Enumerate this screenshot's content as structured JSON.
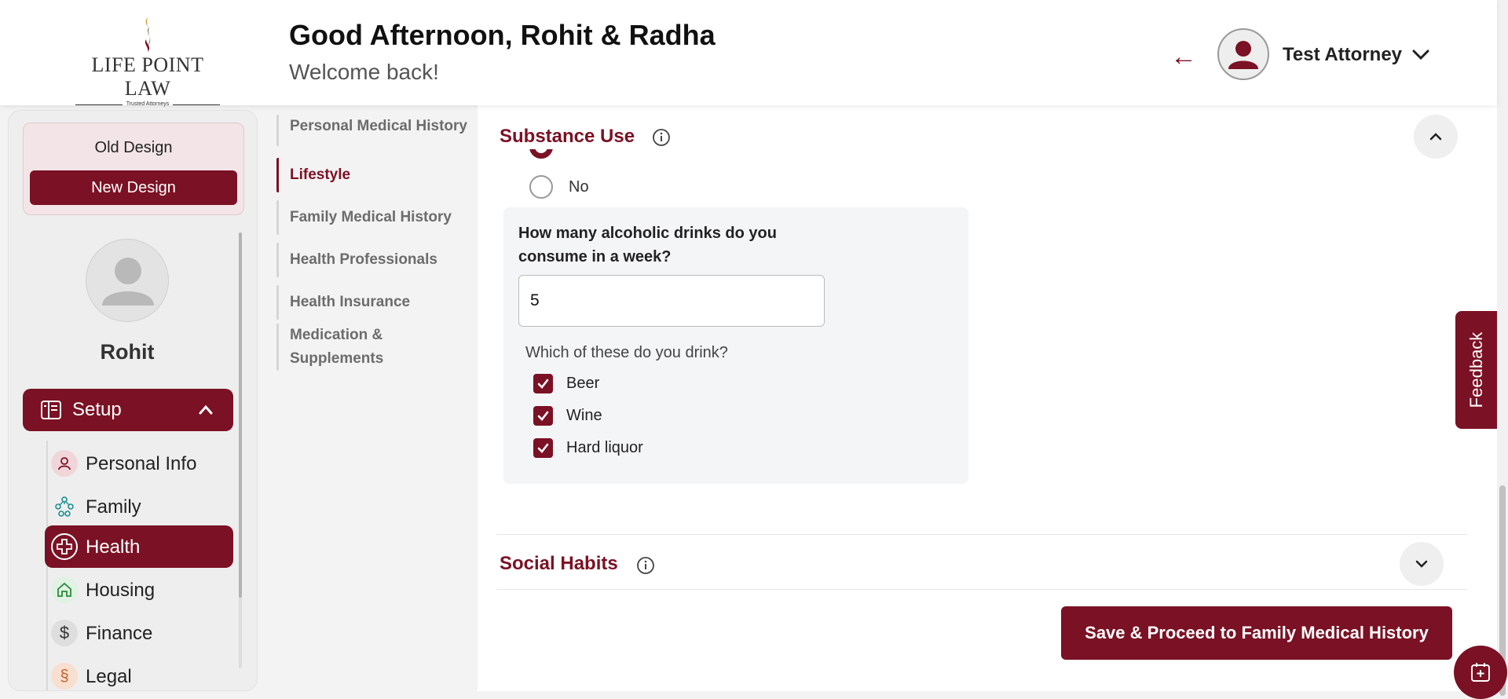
{
  "header": {
    "logo_text": "LIFE POINT LAW",
    "logo_tagline": "Trusted Attorneys",
    "greeting": "Good Afternoon, Rohit & Radha",
    "subtitle": "Welcome back!",
    "user_name": "Test Attorney"
  },
  "sidebar": {
    "old_design": "Old Design",
    "new_design": "New Design",
    "profile_name": "Rohit",
    "setup_label": "Setup",
    "items": [
      {
        "label": "Personal Info",
        "icon": "person-icon"
      },
      {
        "label": "Family",
        "icon": "family-tree-icon"
      },
      {
        "label": "Health",
        "icon": "medical-cross-icon"
      },
      {
        "label": "Housing",
        "icon": "house-icon"
      },
      {
        "label": "Finance",
        "icon": "dollar-icon"
      },
      {
        "label": "Legal",
        "icon": "legal-icon"
      }
    ]
  },
  "subnav": {
    "items": [
      "Personal Medical History",
      "Lifestyle",
      "Family Medical History",
      "Health Professionals",
      "Health Insurance",
      "Medication & Supplements"
    ],
    "active": "Lifestyle"
  },
  "main": {
    "substance_title": "Substance Use",
    "radio_no": "No",
    "question": "How many alcoholic drinks do you consume in a week?",
    "drinks_value": "5",
    "drink_types_label": "Which of these do you drink?",
    "drink_options": [
      {
        "label": "Beer",
        "checked": true
      },
      {
        "label": "Wine",
        "checked": true
      },
      {
        "label": "Hard liquor",
        "checked": true
      }
    ],
    "social_title": "Social Habits",
    "save_button": "Save & Proceed to Family Medical History"
  },
  "feedback": "Feedback",
  "colors": {
    "brand": "#7b1124"
  }
}
